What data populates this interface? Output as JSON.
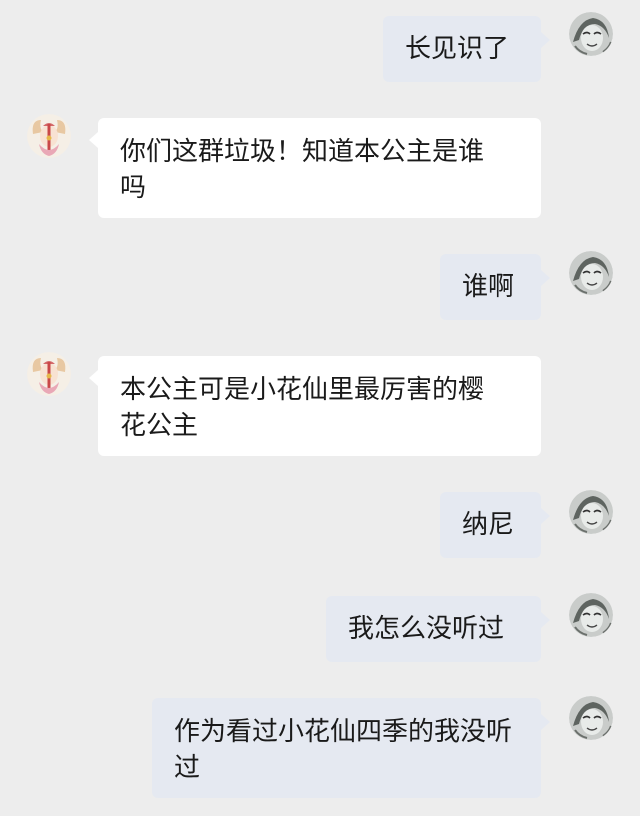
{
  "messages": [
    {
      "side": "sent",
      "text": "长见识了"
    },
    {
      "side": "received",
      "text": "你们这群垃圾！知道本公主是谁吗"
    },
    {
      "side": "sent",
      "text": "谁啊"
    },
    {
      "side": "received",
      "text": "本公主可是小花仙里最厉害的樱花公主"
    },
    {
      "side": "sent",
      "text": "纳尼"
    },
    {
      "side": "sent",
      "text": "我怎么没听过"
    },
    {
      "side": "sent",
      "text": "作为看过小花仙四季的我没听过"
    }
  ],
  "avatars": {
    "self": {
      "icon": "sketch-face-avatar-icon",
      "color": "#9aa09c"
    },
    "other": {
      "icon": "princess-avatar-icon",
      "color": "#e8a98a"
    }
  },
  "colors": {
    "background": "#ededed",
    "sent_bubble": "#e5e9f1",
    "received_bubble": "#ffffff"
  }
}
